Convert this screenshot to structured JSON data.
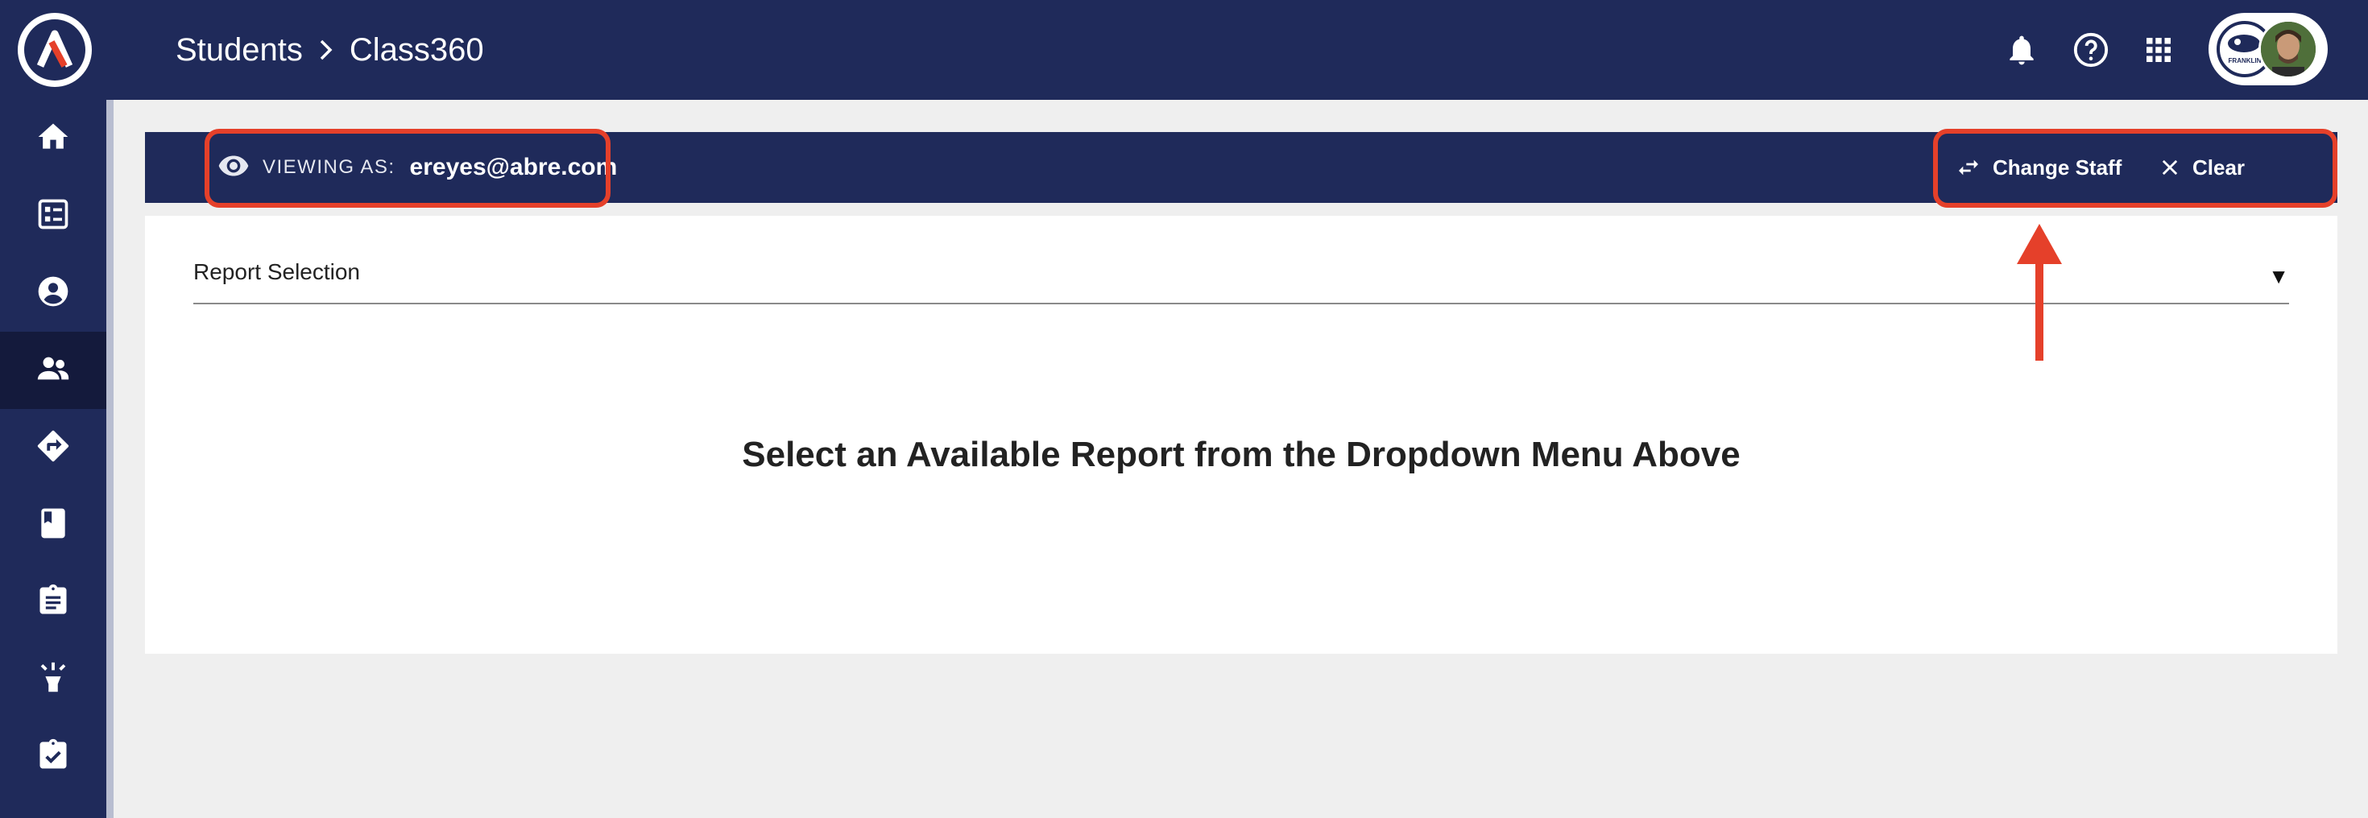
{
  "topbar": {
    "breadcrumb": {
      "section": "Students",
      "page": "Class360"
    },
    "icons": [
      "bell-icon",
      "help-icon",
      "apps-grid-icon"
    ],
    "profile_school_badge": "FRANKLIN"
  },
  "sidebar": {
    "items": [
      {
        "name": "home",
        "icon": "home-icon",
        "active": false
      },
      {
        "name": "dashboard",
        "icon": "checklist-icon",
        "active": false
      },
      {
        "name": "profile",
        "icon": "account-circle-icon",
        "active": false
      },
      {
        "name": "students",
        "icon": "people-icon",
        "active": true
      },
      {
        "name": "directions",
        "icon": "directions-icon",
        "active": false
      },
      {
        "name": "books",
        "icon": "book-icon",
        "active": false
      },
      {
        "name": "assignments",
        "icon": "clipboard-icon",
        "active": false
      },
      {
        "name": "ideas",
        "icon": "lightbulb-icon",
        "active": false
      },
      {
        "name": "tasks",
        "icon": "assignment-check-icon",
        "active": false
      }
    ]
  },
  "banner": {
    "viewing_label": "VIEWING AS:",
    "viewing_email": "ereyes@abre.com",
    "change_staff_label": "Change Staff",
    "clear_label": "Clear"
  },
  "main": {
    "report_selection_label": "Report Selection",
    "report_caret": "▼",
    "empty_message": "Select an Available Report from the Dropdown Menu Above"
  },
  "colors": {
    "brand_navy": "#1f2a5a",
    "highlight_red": "#e5402a",
    "background": "#efefef"
  }
}
